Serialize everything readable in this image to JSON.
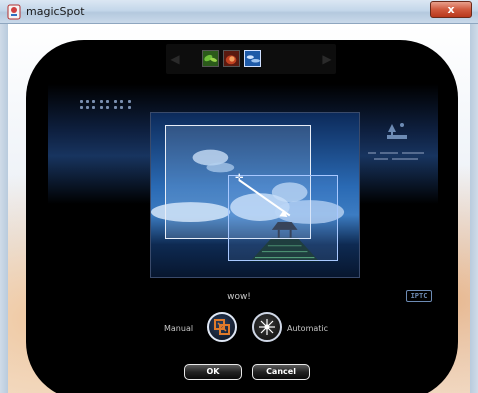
{
  "window": {
    "title": "magicSpot",
    "close_label": "x"
  },
  "thumbnails": {
    "prev_arrow": "◀",
    "next_arrow": "▶",
    "items": [
      {
        "name": "thumb-green-leaves"
      },
      {
        "name": "thumb-red-fire"
      },
      {
        "name": "thumb-blue-sky"
      }
    ]
  },
  "photo": {
    "caption": "wow!"
  },
  "badge": {
    "iptc_label": "IPTC"
  },
  "modes": {
    "manual_label": "Manual",
    "automatic_label": "Automatic",
    "active": "manual"
  },
  "buttons": {
    "ok_label": "OK",
    "cancel_label": "Cancel"
  },
  "colors": {
    "panel_bg": "#000000",
    "accent_blue": "#6d8bb4",
    "manual_icon": "#e07a2a"
  }
}
